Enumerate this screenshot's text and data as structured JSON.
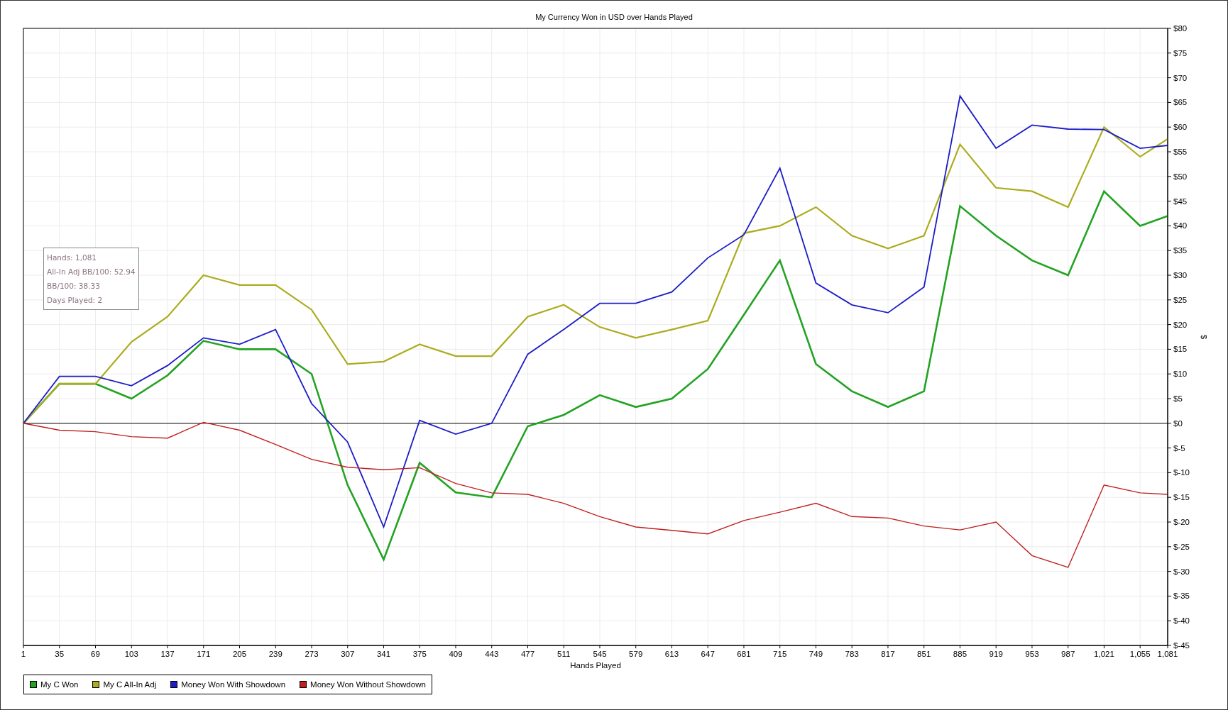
{
  "chart": {
    "chart_data": {
      "type": "line",
      "title": "My Currency Won in USD over Hands Played",
      "xlabel": "Hands Played",
      "ylabel": "$",
      "x": [
        1,
        35,
        69,
        103,
        137,
        171,
        205,
        239,
        273,
        307,
        341,
        375,
        409,
        443,
        477,
        511,
        545,
        579,
        613,
        647,
        681,
        715,
        749,
        783,
        817,
        851,
        885,
        919,
        953,
        987,
        1021,
        1055,
        1081
      ],
      "series": [
        {
          "name": "My C Won",
          "color": "#22a322",
          "values": [
            0,
            8,
            8,
            5,
            9.7,
            16.7,
            15,
            15,
            10,
            -12.5,
            -27.6,
            -8,
            -14,
            -15,
            -0.6,
            1.7,
            5.7,
            3.3,
            5,
            11,
            22,
            33,
            12,
            6.5,
            3.3,
            6.5,
            44,
            38,
            33,
            30,
            47,
            40,
            42
          ]
        },
        {
          "name": "My C All-In Adj",
          "color": "#acac1e",
          "values": [
            0,
            8,
            8,
            16.5,
            21.6,
            30,
            28,
            28,
            23,
            12,
            12.5,
            16,
            13.6,
            13.6,
            21.6,
            24,
            19.5,
            17.3,
            19,
            20.8,
            38.5,
            40,
            43.8,
            38,
            35.4,
            38,
            56.5,
            47.7,
            47,
            43.8,
            60,
            54,
            57.6
          ]
        },
        {
          "name": "Money Won With Showdown",
          "color": "#1c1cc8",
          "values": [
            0,
            9.5,
            9.5,
            7.6,
            11.7,
            17.3,
            16,
            19,
            4,
            -3.8,
            -21,
            0.6,
            -2.2,
            0,
            14,
            19,
            24.3,
            24.3,
            26.6,
            33.5,
            38.2,
            51.7,
            28.4,
            24,
            22.4,
            27.6,
            66.3,
            55.7,
            60.4,
            59.6,
            59.5,
            55.7,
            56.3
          ]
        },
        {
          "name": "Money Won Without Showdown",
          "color": "#c02020",
          "values": [
            0,
            -1.4,
            -1.7,
            -2.7,
            -3,
            0.2,
            -1.4,
            -4.3,
            -7.3,
            -8.9,
            -9.4,
            -9,
            -12.2,
            -14.1,
            -14.4,
            -16.2,
            -18.9,
            -21,
            -21.7,
            -22.4,
            -19.7,
            -18,
            -16.2,
            -18.9,
            -19.2,
            -20.8,
            -21.6,
            -20,
            -26.8,
            -29.2,
            -12.5,
            -14.1,
            -14.4
          ]
        }
      ],
      "xlim": [
        1,
        1081
      ],
      "ylim": [
        -45,
        80
      ],
      "grid": true,
      "xticks": [
        1,
        35,
        69,
        103,
        137,
        171,
        205,
        239,
        273,
        307,
        341,
        375,
        409,
        443,
        477,
        511,
        545,
        579,
        613,
        647,
        681,
        715,
        749,
        783,
        817,
        851,
        885,
        919,
        953,
        987,
        {
          "value": 1021,
          "label": "1,021"
        },
        {
          "value": 1055,
          "label": "1,055"
        },
        {
          "value": 1081,
          "label": "1,081"
        }
      ],
      "yticks": [
        {
          "value": 80,
          "label": "$80"
        },
        {
          "value": 75,
          "label": "$75"
        },
        {
          "value": 70,
          "label": "$70"
        },
        {
          "value": 65,
          "label": "$65"
        },
        {
          "value": 60,
          "label": "$60"
        },
        {
          "value": 55,
          "label": "$55"
        },
        {
          "value": 50,
          "label": "$50"
        },
        {
          "value": 45,
          "label": "$45"
        },
        {
          "value": 40,
          "label": "$40"
        },
        {
          "value": 35,
          "label": "$35"
        },
        {
          "value": 30,
          "label": "$30"
        },
        {
          "value": 25,
          "label": "$25"
        },
        {
          "value": 20,
          "label": "$20"
        },
        {
          "value": 15,
          "label": "$15"
        },
        {
          "value": 10,
          "label": "$10"
        },
        {
          "value": 5,
          "label": "$5"
        },
        {
          "value": 0,
          "label": "$0"
        },
        {
          "value": -5,
          "label": "$-5"
        },
        {
          "value": -10,
          "label": "$-10"
        },
        {
          "value": -15,
          "label": "$-15"
        },
        {
          "value": -20,
          "label": "$-20"
        },
        {
          "value": -25,
          "label": "$-25"
        },
        {
          "value": -30,
          "label": "$-30"
        },
        {
          "value": -35,
          "label": "$-35"
        },
        {
          "value": -40,
          "label": "$-40"
        },
        {
          "value": -45,
          "label": "$-45"
        }
      ]
    },
    "tooltip": {
      "lines": [
        "Hands: 1,081",
        "All-In Adj BB/100: 52.94",
        "BB/100: 38.33",
        "Days Played: 2"
      ]
    }
  }
}
